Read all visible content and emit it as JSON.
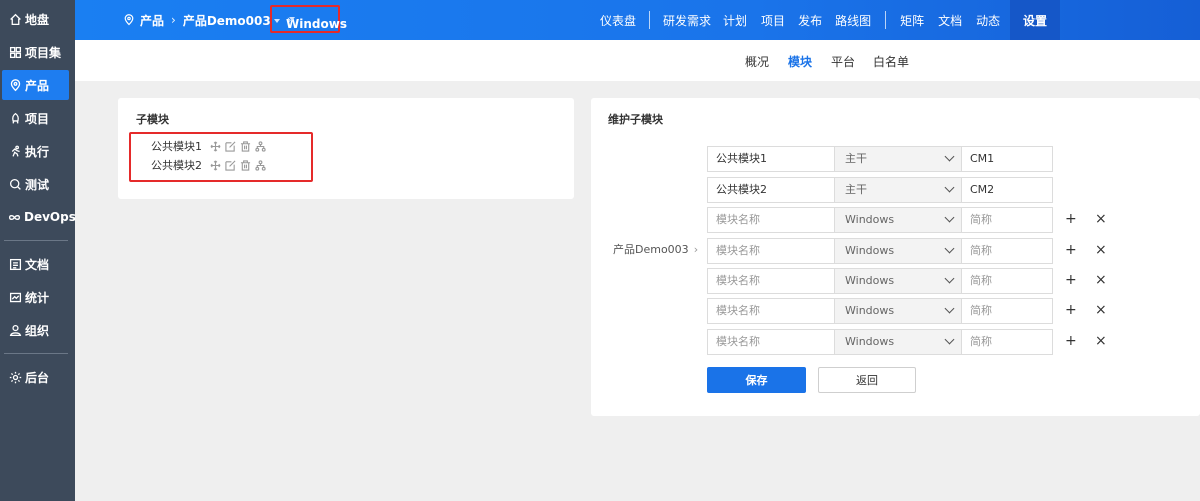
{
  "sidebar": {
    "items": [
      {
        "label": "地盘",
        "icon": "home-icon"
      },
      {
        "label": "项目集",
        "icon": "grid-icon"
      },
      {
        "label": "产品",
        "icon": "product-icon"
      },
      {
        "label": "项目",
        "icon": "project-icon"
      },
      {
        "label": "执行",
        "icon": "run-icon"
      },
      {
        "label": "测试",
        "icon": "test-icon"
      },
      {
        "label": "DevOps",
        "icon": "infinity-icon"
      },
      {
        "label": "文档",
        "icon": "doc-icon"
      },
      {
        "label": "统计",
        "icon": "chart-icon"
      },
      {
        "label": "组织",
        "icon": "user-icon"
      },
      {
        "label": "后台",
        "icon": "gear-icon"
      }
    ]
  },
  "header": {
    "crumb_root": "产品",
    "crumb_product": "产品Demo003",
    "crumb_platform": "Windows",
    "nav": [
      "仪表盘",
      "研发需求",
      "计划",
      "项目",
      "发布",
      "路线图",
      "矩阵",
      "文档",
      "动态"
    ],
    "settings": "设置"
  },
  "subnav": {
    "tabs": [
      "概况",
      "模块",
      "平台",
      "白名单"
    ]
  },
  "left_card": {
    "title": "子模块",
    "modules": [
      "公共模块1",
      "公共模块2"
    ]
  },
  "right_card": {
    "title": "维护子模块",
    "product": "产品Demo003",
    "rows": [
      {
        "name": "公共模块1",
        "branch": "主干",
        "short": "CM1"
      },
      {
        "name": "公共模块2",
        "branch": "主干",
        "short": "CM2"
      }
    ],
    "name_placeholder": "模块名称",
    "branch_default": "Windows",
    "short_placeholder": "简称",
    "add": "+",
    "remove": "×",
    "save": "保存",
    "back": "返回"
  }
}
